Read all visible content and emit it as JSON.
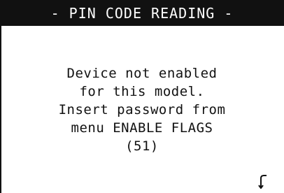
{
  "header": {
    "title": "- PIN CODE READING -"
  },
  "message": {
    "lines": [
      "Device not enabled",
      "for this model.",
      "Insert password from",
      "menu ENABLE FLAGS",
      "(51)"
    ]
  },
  "controls": {
    "back_icon": "return-arrow-icon"
  },
  "colors": {
    "background": "#ffffff",
    "title_bar": "#111111",
    "text": "#111111"
  }
}
